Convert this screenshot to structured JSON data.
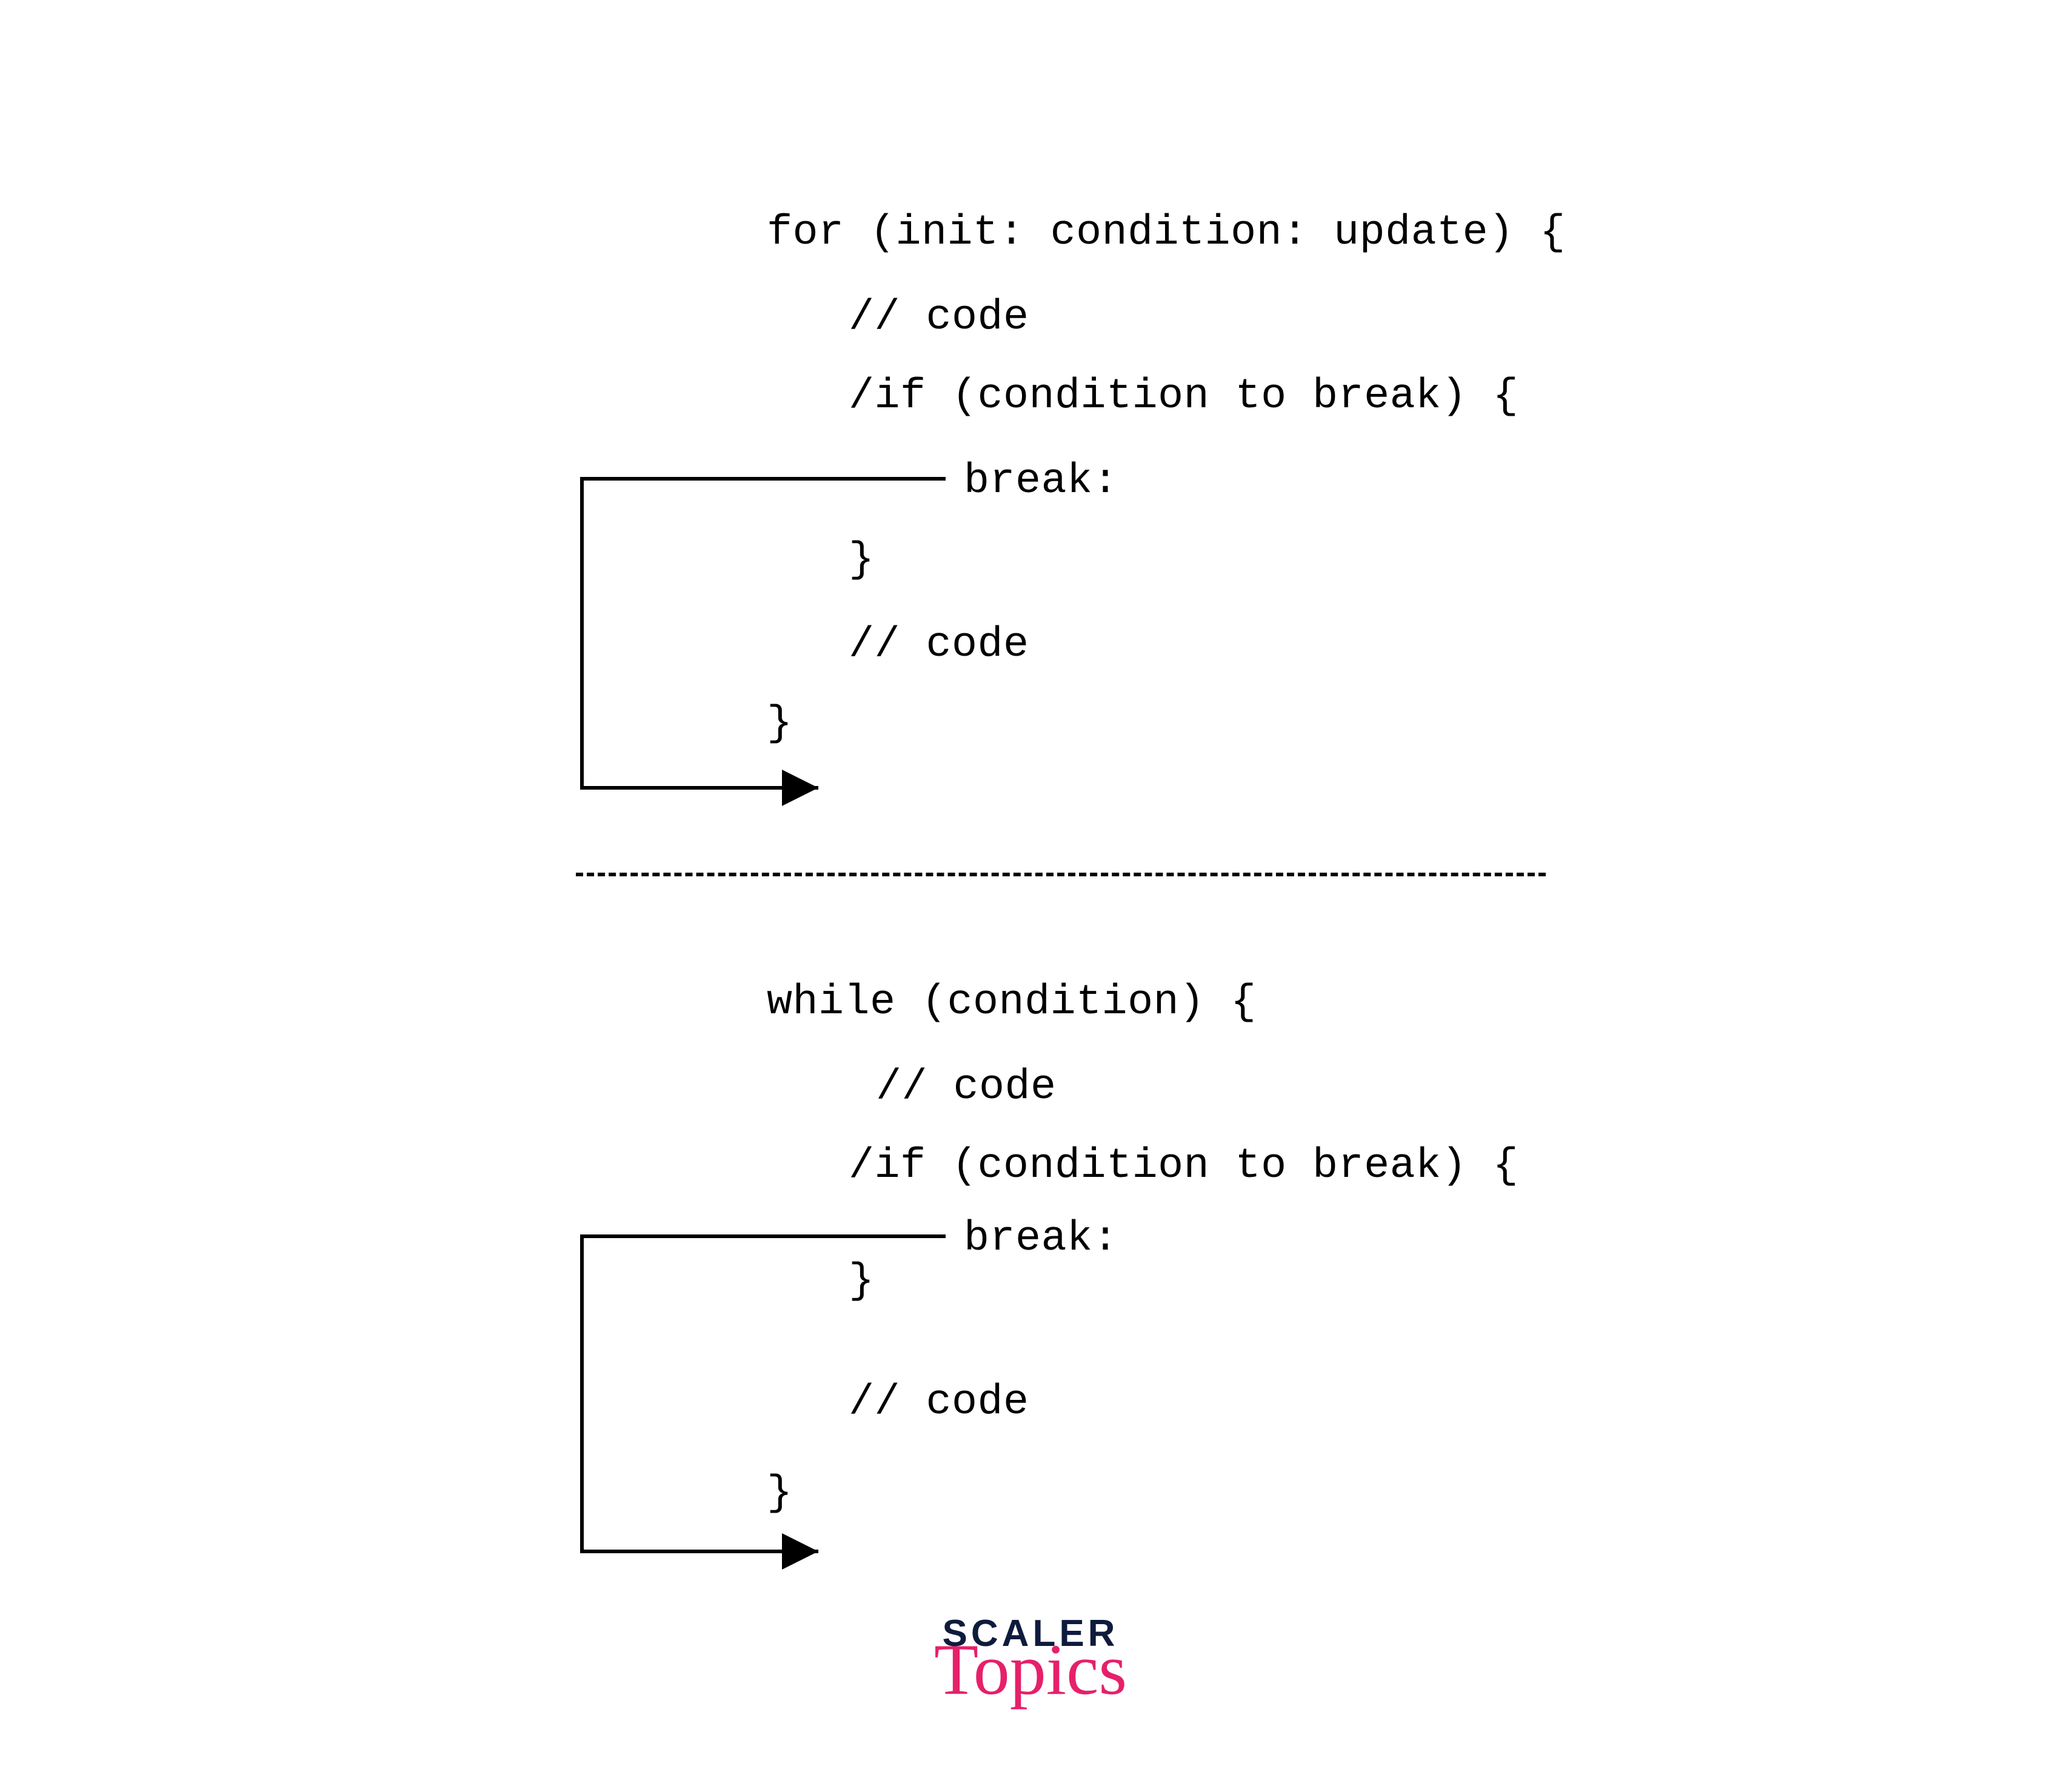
{
  "block1": {
    "l1": "for (init: condition: update) {",
    "l2": "// code",
    "l3": "/if (condition to break) {",
    "l4": "break:",
    "l5": "}",
    "l6": "// code",
    "l7": "}"
  },
  "block2": {
    "m1": "while (condition) {",
    "m2": "// code",
    "m3": "/if (condition to break) {",
    "m4": "break:",
    "m5": "}",
    "m6": "// code",
    "m7": "}"
  },
  "logo": {
    "scaler": "SCALER",
    "topics": "Topics"
  }
}
